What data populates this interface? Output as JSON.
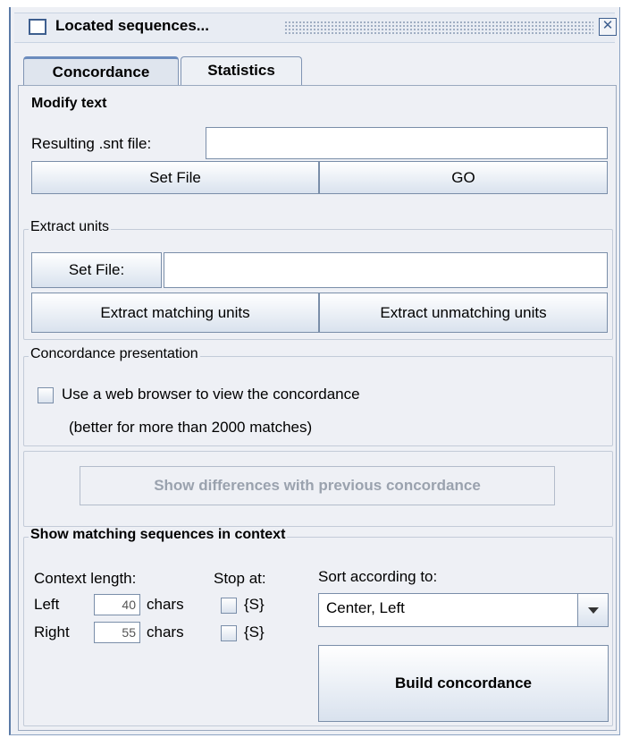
{
  "window": {
    "title": "Located sequences..."
  },
  "tabs": [
    {
      "label": "Concordance",
      "active": true
    },
    {
      "label": "Statistics",
      "active": false
    }
  ],
  "modify_text": {
    "legend": "Modify text",
    "resulting_label": "Resulting .snt file:",
    "resulting_value": "",
    "set_file_button": "Set File",
    "go_button": "GO"
  },
  "extract_units": {
    "legend": "Extract units",
    "set_file_button": "Set File:",
    "file_value": "",
    "extract_matching_button": "Extract matching units",
    "extract_unmatching_button": "Extract unmatching units"
  },
  "presentation": {
    "legend": "Concordance presentation",
    "web_browser_checkbox_label": "Use a web browser to view the concordance",
    "web_browser_checked": false,
    "hint": "(better for more than 2000 matches)"
  },
  "differences": {
    "button_label": "Show differences with previous concordance",
    "enabled": false
  },
  "context": {
    "legend": "Show matching sequences in context",
    "context_length_label": "Context length:",
    "stop_at_label": "Stop at:",
    "sort_label": "Sort according to:",
    "left_label": "Left",
    "left_value": "40",
    "right_label": "Right",
    "right_value": "55",
    "chars_label": "chars",
    "stop_left_label": "{S}",
    "stop_right_label": "{S}",
    "stop_left_checked": false,
    "stop_right_checked": false,
    "sort_selected": "Center, Left",
    "build_button": "Build concordance"
  }
}
